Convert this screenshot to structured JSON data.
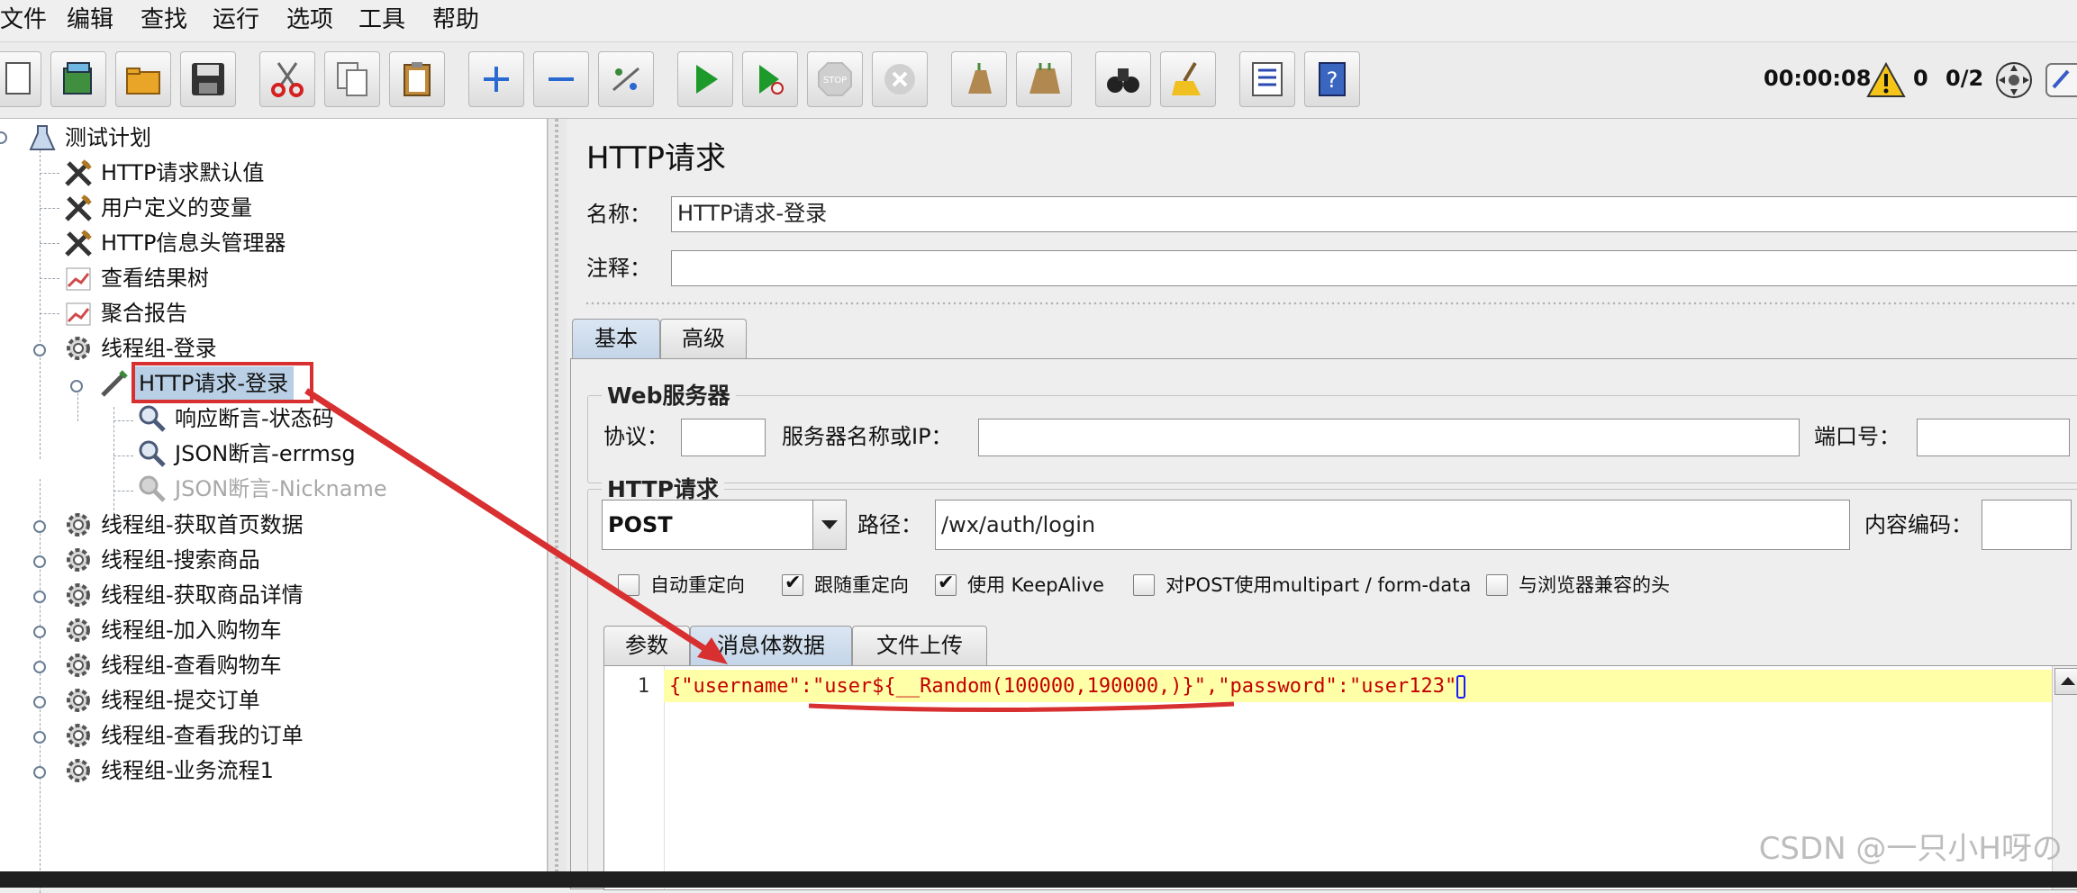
{
  "menu": [
    "文件",
    "编辑",
    "查找",
    "运行",
    "选项",
    "工具",
    "帮助"
  ],
  "toolbar": {
    "buttons": [
      "new-icon",
      "templates-icon",
      "open-icon",
      "save-icon",
      "cut-icon",
      "copy-icon",
      "paste-icon",
      "expand-icon",
      "collapse-icon",
      "toggle-icon",
      "start-icon",
      "start-no-pause-icon",
      "stop-icon",
      "shutdown-icon",
      "clear-icon",
      "clear-all-icon",
      "search-icon",
      "reset-search-icon",
      "function-helper-icon",
      "help-icon"
    ],
    "timer": "00:00:08",
    "warning_count": "0",
    "threads": "0/2"
  },
  "tree": [
    {
      "label": "测试计划",
      "icon": "test-plan-icon",
      "level": 0
    },
    {
      "label": "HTTP请求默认值",
      "icon": "config-tools-icon",
      "level": 1
    },
    {
      "label": "用户定义的变量",
      "icon": "config-tools-icon",
      "level": 1
    },
    {
      "label": "HTTP信息头管理器",
      "icon": "config-tools-icon",
      "level": 1
    },
    {
      "label": "查看结果树",
      "icon": "listener-chart-icon",
      "level": 1
    },
    {
      "label": "聚合报告",
      "icon": "listener-chart-icon",
      "level": 1
    },
    {
      "label": "线程组-登录",
      "icon": "thread-group-gear-icon",
      "level": 1
    },
    {
      "label": "HTTP请求-登录",
      "icon": "sampler-pen-icon",
      "level": 2
    },
    {
      "label": "响应断言-状态码",
      "icon": "assertion-magnifier-icon",
      "level": 3
    },
    {
      "label": "JSON断言-errmsg",
      "icon": "assertion-magnifier-icon",
      "level": 3
    },
    {
      "label": "JSON断言-Nickname",
      "icon": "assertion-magnifier-icon",
      "level": 3
    },
    {
      "label": "线程组-获取首页数据",
      "icon": "thread-group-gear-icon",
      "level": 1
    },
    {
      "label": "线程组-搜索商品",
      "icon": "thread-group-gear-icon",
      "level": 1
    },
    {
      "label": "线程组-获取商品详情",
      "icon": "thread-group-gear-icon",
      "level": 1
    },
    {
      "label": "线程组-加入购物车",
      "icon": "thread-group-gear-icon",
      "level": 1
    },
    {
      "label": "线程组-查看购物车",
      "icon": "thread-group-gear-icon",
      "level": 1
    },
    {
      "label": "线程组-提交订单",
      "icon": "thread-group-gear-icon",
      "level": 1
    },
    {
      "label": "线程组-查看我的订单",
      "icon": "thread-group-gear-icon",
      "level": 1
    },
    {
      "label": "线程组-业务流程1",
      "icon": "thread-group-gear-icon",
      "level": 1
    }
  ],
  "panel": {
    "title": "HTTP请求",
    "name_label": "名称：",
    "name_value": "HTTP请求-登录",
    "comment_label": "注释：",
    "comment_value": "",
    "tabs": [
      "基本",
      "高级"
    ],
    "web_server": {
      "group_label": "Web服务器",
      "protocol_label": "协议：",
      "protocol_value": "",
      "server_label": "服务器名称或IP：",
      "server_value": "",
      "port_label": "端口号：",
      "port_value": ""
    },
    "http_request": {
      "group_label": "HTTP请求",
      "method": "POST",
      "path_label": "路径：",
      "path_value": "/wx/auth/login",
      "encoding_label": "内容编码：",
      "encoding_value": ""
    },
    "checkboxes": [
      {
        "label": "自动重定向",
        "checked": false
      },
      {
        "label": "跟随重定向",
        "checked": true
      },
      {
        "label": "使用 KeepAlive",
        "checked": true
      },
      {
        "label": "对POST使用multipart / form-data",
        "checked": false
      },
      {
        "label": "与浏览器兼容的头",
        "checked": false
      }
    ],
    "subtabs": [
      "参数",
      "消息体数据",
      "文件上传"
    ],
    "editor": {
      "line_number": "1",
      "code_part1": "{\"username\":",
      "code_part2": "\"user${__Random(100000,190000,)}",
      "code_part3": "\",\"password\":\"user123\"",
      "code_part4": "}"
    }
  },
  "watermark": "CSDN @一只小H呀の"
}
